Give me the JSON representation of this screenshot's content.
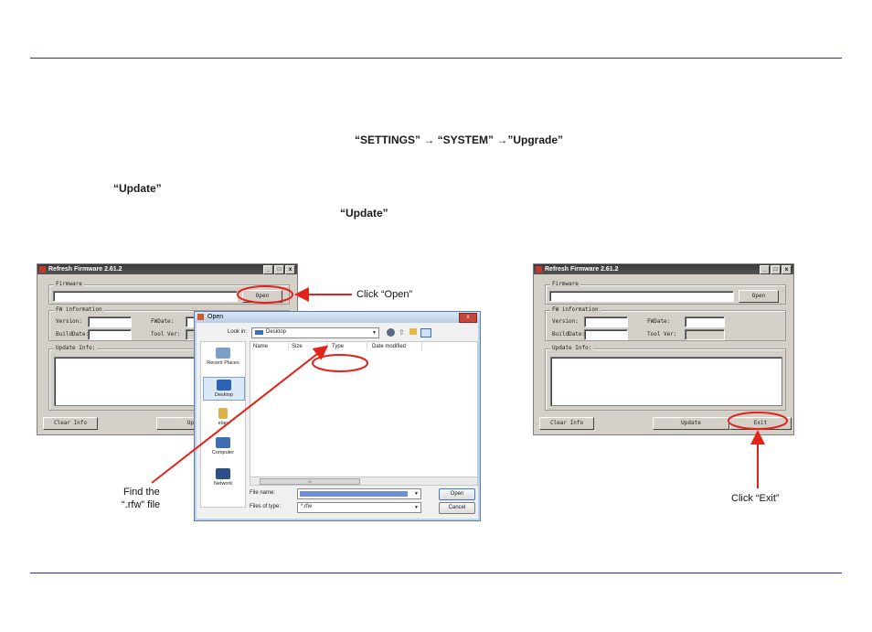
{
  "instructions": {
    "settings_path": "“SETTINGS” → “SYSTEM” →”Upgrade”",
    "update_1": "“Update”",
    "update_2": "“Update”"
  },
  "firmware_window": {
    "title": "Refresh Firmware 2.61.2",
    "controls": [
      "_",
      "□",
      "x"
    ],
    "firmware_group": "Firmware",
    "open_button": "Open",
    "fw_info_group": "FW information",
    "version_label": "Version:",
    "fwdate_label": "FWDate:",
    "build_label": "BuildDate:",
    "tool_ver_label": "Tool Ver:",
    "update_info_group": "Update Info:",
    "clear_info_button": "Clear Info",
    "update_button": "Update",
    "update_button_partial": "Up",
    "exit_button": "Exit"
  },
  "open_dialog": {
    "title": "Open",
    "close": "x",
    "look_in_label": "Look in:",
    "look_in_value": "Desktop",
    "columns": [
      "Name",
      "Size",
      "Type",
      "Date modified"
    ],
    "places": [
      "Recent Places",
      "Desktop",
      "elan",
      "Computer",
      "Network"
    ],
    "file_name_label": "File name:",
    "files_of_type_label": "Files of type:",
    "files_of_type_value": "*.rfw",
    "open_button": "Open",
    "cancel_button": "Cancel",
    "scroll_value": "III"
  },
  "annotations": {
    "click_open": "Click “Open”",
    "find_file_line1": "Find the",
    "find_file_line2": "“.rfw” file",
    "click_exit": "Click “Exit”"
  },
  "colors": {
    "rule": "#2e3192",
    "callout": "#e2231a"
  }
}
